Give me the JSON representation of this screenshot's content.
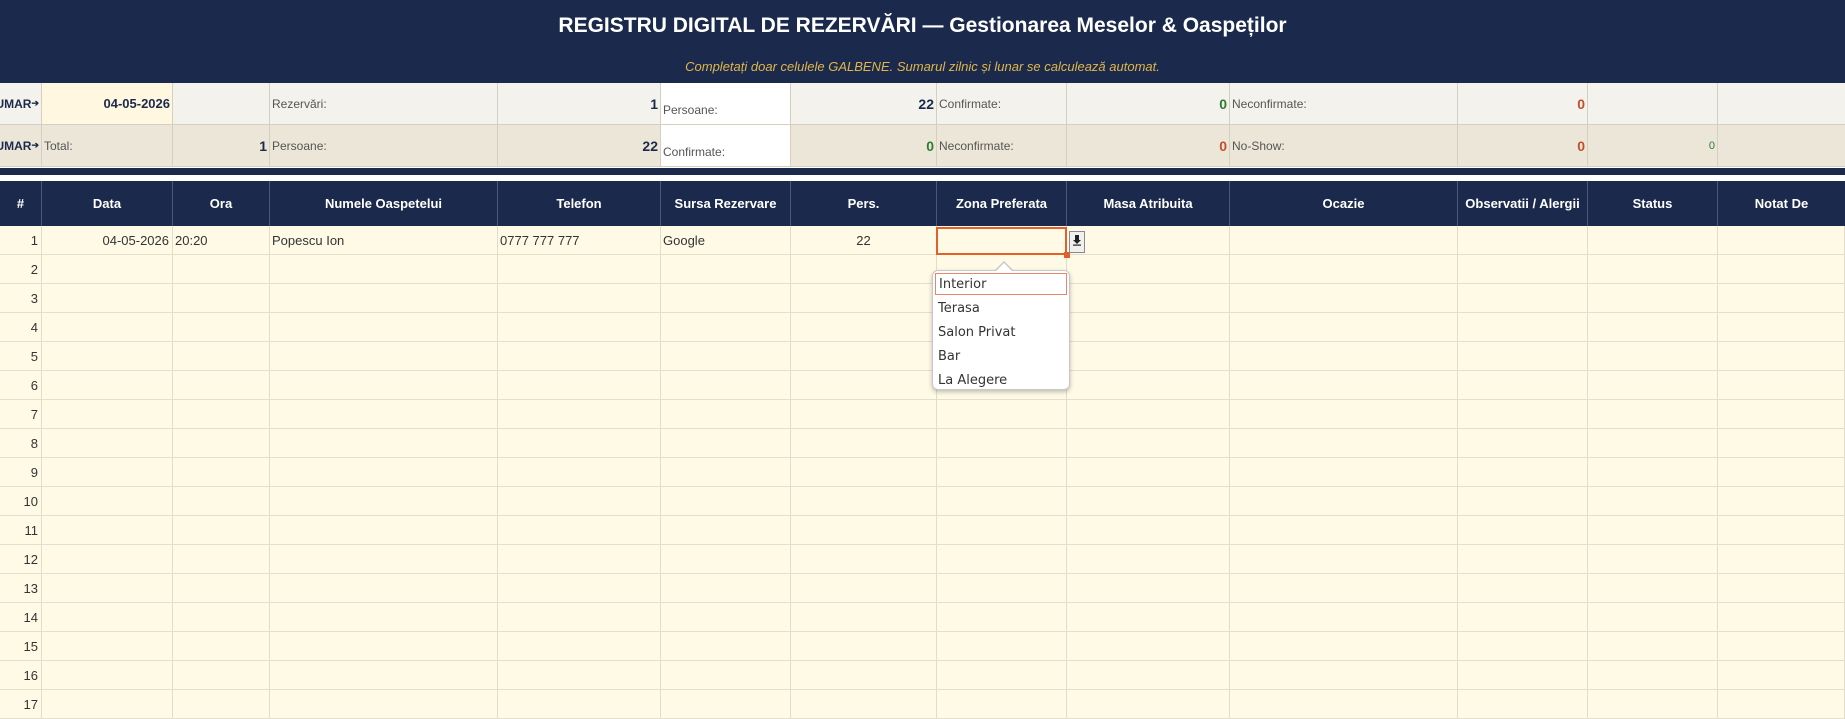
{
  "header": {
    "title": "REGISTRU DIGITAL DE REZERVĂRI  —  Gestionarea Meselor & Oaspeților",
    "subtitle": "Completați doar celulele GALBENE. Sumarul zilnic și lunar se calculează automat."
  },
  "summary_daily": {
    "label": "SUMAR",
    "date": "04-05-2026",
    "rezervari_label": "Rezervări:",
    "rezervari_value": "1",
    "persoane_label": "Persoane:",
    "persoane_value": "22",
    "confirmate_label": "Confirmate:",
    "confirmate_value": "0",
    "neconfirmate_label": "Neconfirmate:",
    "neconfirmate_value": "0"
  },
  "summary_monthly": {
    "label": "SUMAR",
    "total_label": "Total:",
    "total_value": "1",
    "persoane_label": "Persoane:",
    "persoane_value": "22",
    "confirmate_label": "Confirmate:",
    "confirmate_value": "0",
    "neconfirmate_label": "Neconfirmate:",
    "neconfirmate_value": "0",
    "noshow_label": "No-Show:",
    "noshow_value": "0",
    "extra_value": "0"
  },
  "table": {
    "columns": [
      "#",
      "Data",
      "Ora",
      "Numele Oaspetelui",
      "Telefon",
      "Sursa Rezervare",
      "Pers.",
      "Zona Preferata",
      "Masa Atribuita",
      "Ocazie",
      "Observatii / Alergii",
      "Status",
      "Notat De"
    ],
    "rows": [
      {
        "num": "1",
        "data": "04-05-2026",
        "ora": "20:20",
        "nume": "Popescu Ion",
        "telefon": "0777 777 777",
        "sursa": "Google",
        "pers": "22"
      },
      {
        "num": "2"
      },
      {
        "num": "3"
      },
      {
        "num": "4"
      },
      {
        "num": "5"
      },
      {
        "num": "6"
      },
      {
        "num": "7"
      },
      {
        "num": "8"
      },
      {
        "num": "9"
      },
      {
        "num": "10"
      },
      {
        "num": "11"
      },
      {
        "num": "12"
      },
      {
        "num": "13"
      },
      {
        "num": "14"
      },
      {
        "num": "15"
      },
      {
        "num": "16"
      },
      {
        "num": "17"
      }
    ]
  },
  "dropdown": {
    "options": [
      "Interior",
      "Terasa",
      "Salon Privat",
      "Bar",
      "La Alegere"
    ],
    "selected_option": "Interior"
  },
  "colors": {
    "header_bg": "#1b2a4c",
    "subtitle_text": "#e0b64a",
    "input_cell_bg": "#fffae6",
    "positive_value": "#2e7d32",
    "negative_value": "#c0502b",
    "active_cell_border": "#e0622a"
  }
}
